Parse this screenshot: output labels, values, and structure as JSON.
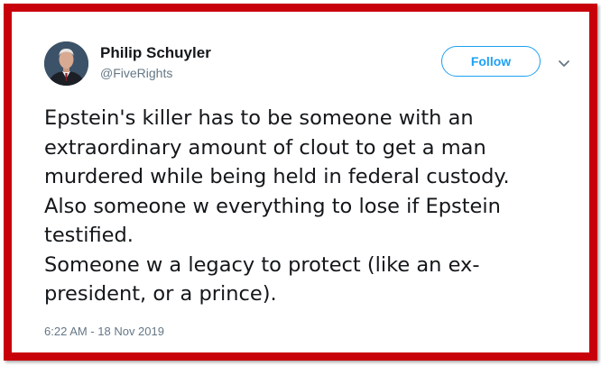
{
  "colors": {
    "frame_border": "#c8000a",
    "accent": "#1da1f2",
    "text_primary": "#14171a",
    "text_secondary": "#657786"
  },
  "author": {
    "display_name": "Philip Schuyler",
    "handle": "@FiveRights",
    "avatar_icon": "profile-photo"
  },
  "actions": {
    "follow_label": "Follow",
    "more_icon": "chevron-down-icon"
  },
  "tweet": {
    "lines": [
      "Epstein's killer has to be someone with an",
      "extraordinary amount of clout to get a man",
      "murdered while being held in federal custody.",
      "Also someone w everything to lose if Epstein",
      "testified.",
      "Someone w a legacy to protect (like an ex-",
      "president, or a prince)."
    ],
    "timestamp": "6:22 AM - 18 Nov 2019"
  }
}
